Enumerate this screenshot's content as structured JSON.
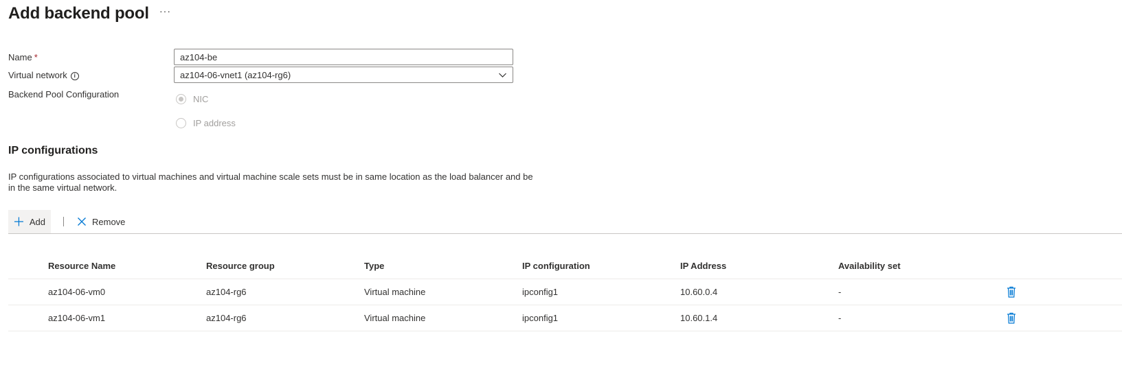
{
  "header": {
    "title": "Add backend pool",
    "more_label": "···"
  },
  "form": {
    "name_label": "Name",
    "name_required": "*",
    "name_value": "az104-be",
    "vnet_label": "Virtual network",
    "vnet_info": "i",
    "vnet_value": "az104-06-vnet1 (az104-rg6)",
    "config_label": "Backend Pool Configuration",
    "config_options": [
      {
        "label": "NIC",
        "checked": true
      },
      {
        "label": "IP address",
        "checked": false
      }
    ]
  },
  "ip_section": {
    "title": "IP configurations",
    "description": "IP configurations associated to virtual machines and virtual machine scale sets must be in same location as the load balancer and be in the same virtual network."
  },
  "toolbar": {
    "add_label": "Add",
    "remove_label": "Remove"
  },
  "table": {
    "columns": [
      "Resource Name",
      "Resource group",
      "Type",
      "IP configuration",
      "IP Address",
      "Availability set"
    ],
    "rows": [
      [
        "az104-06-vm0",
        "az104-rg6",
        "Virtual machine",
        "ipconfig1",
        "10.60.0.4",
        "-"
      ],
      [
        "az104-06-vm1",
        "az104-rg6",
        "Virtual machine",
        "ipconfig1",
        "10.60.1.4",
        "-"
      ]
    ]
  },
  "colors": {
    "accent": "#0078d4",
    "required": "#a4262c",
    "disabled_text": "#a19f9d"
  },
  "icons": {
    "more": "ellipsis-icon",
    "info": "info-icon",
    "dropdown": "chevron-down-icon",
    "add": "plus-icon",
    "remove": "close-icon",
    "delete": "trash-icon"
  }
}
